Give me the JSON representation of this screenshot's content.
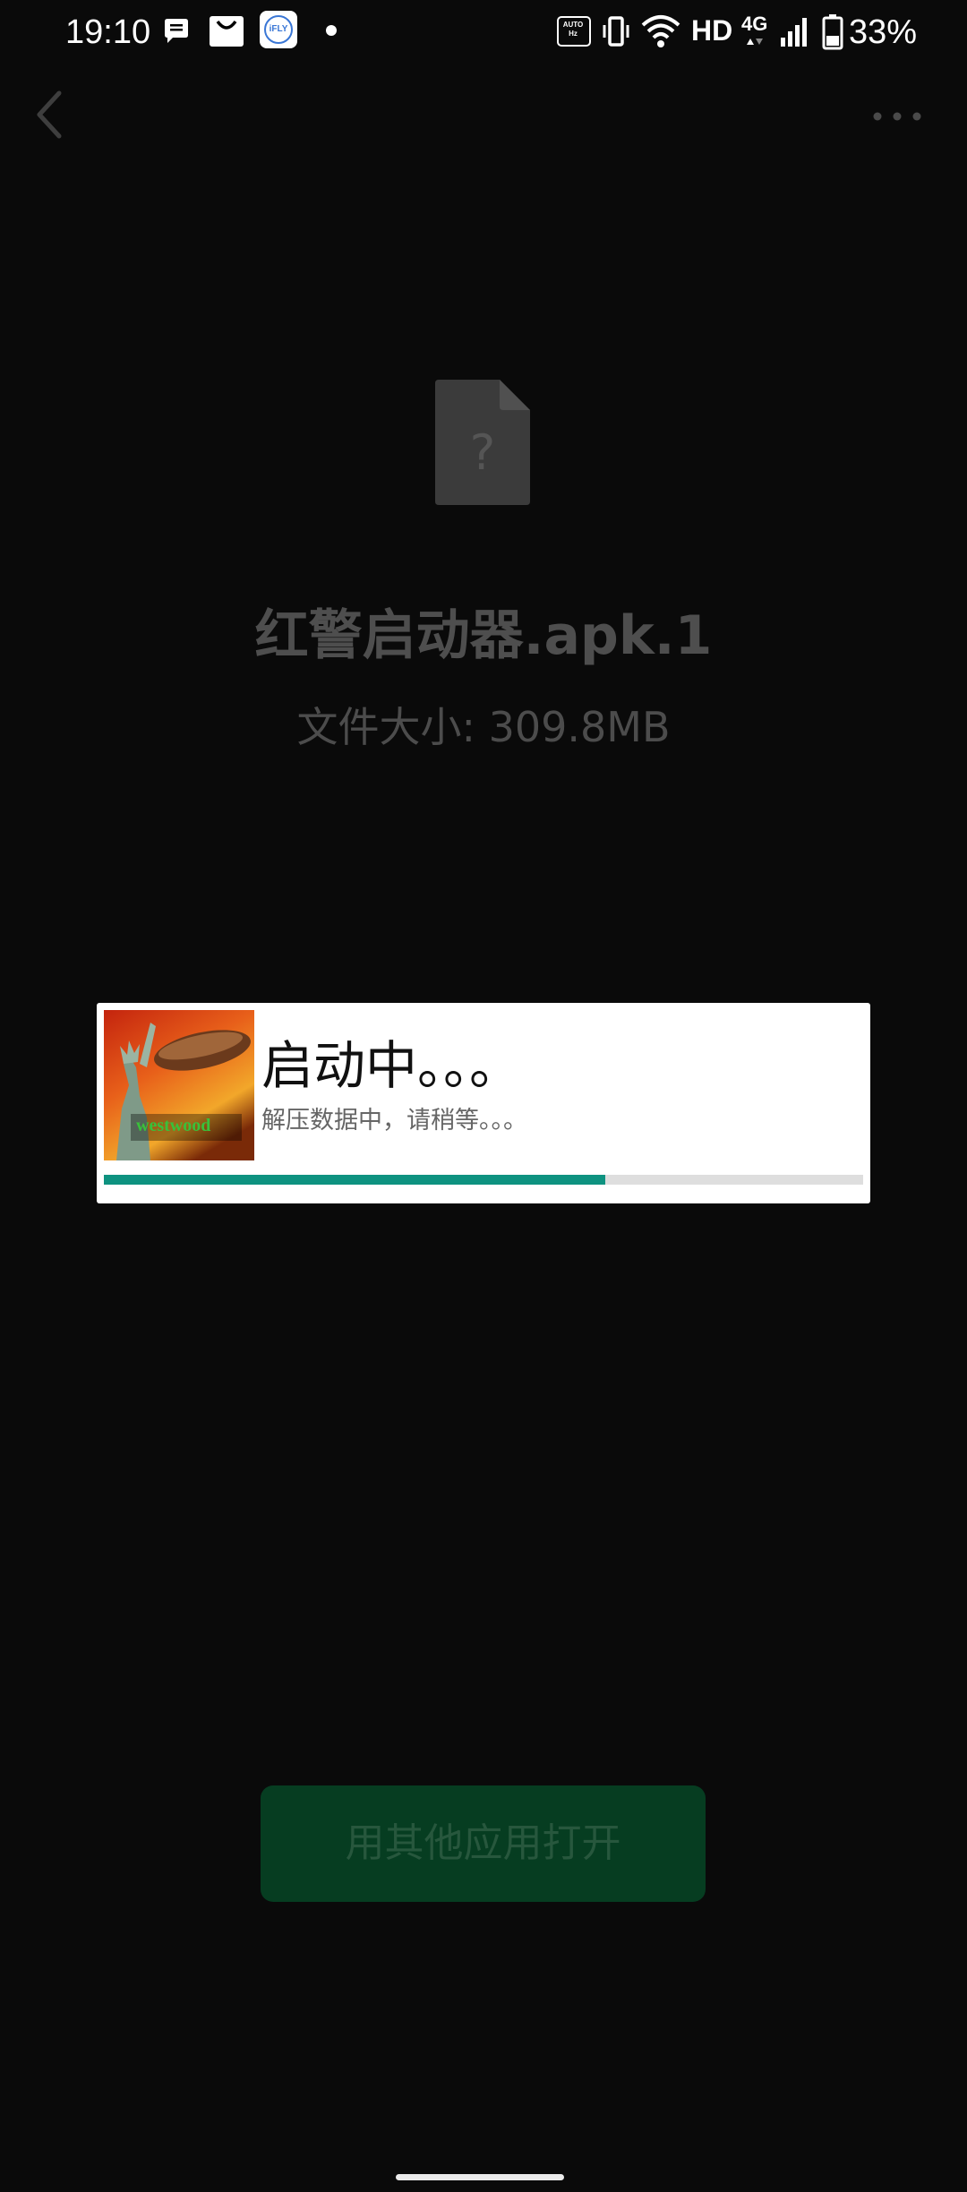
{
  "status_bar": {
    "time": "19:10",
    "notification_icons": [
      "message-bubble-icon",
      "shopping-bag-icon",
      "ifly-app-icon"
    ],
    "ifly_label": "iFLY",
    "auto_hz_label": "AUTO Hz",
    "vibrate_icon": "vibrate-icon",
    "wifi_icon": "wifi-icon",
    "network_hd": "HD",
    "network_type": "4G",
    "signal_icon": "signal-bars-icon",
    "battery_icon": "battery-icon",
    "battery_percent": "33%"
  },
  "app_bar": {
    "back_icon": "chevron-left-icon",
    "more_icon": "more-dots-icon"
  },
  "file": {
    "icon": "unknown-file-icon",
    "name": "红警启动器.apk.1",
    "size_text": "文件大小: 309.8MB"
  },
  "loading_dialog": {
    "thumbnail": "game-cover-image",
    "thumbnail_label": "westwood",
    "title": "启动中。。。",
    "subtitle": "解压数据中，请稍等。。。",
    "progress_percent": 66,
    "progress_color": "#0e9280"
  },
  "open_with_button": {
    "label": "用其他应用打开",
    "background_color": "#063d21"
  },
  "colors": {
    "background": "#0a0a0a",
    "dim_text": "#4e4e4e"
  }
}
